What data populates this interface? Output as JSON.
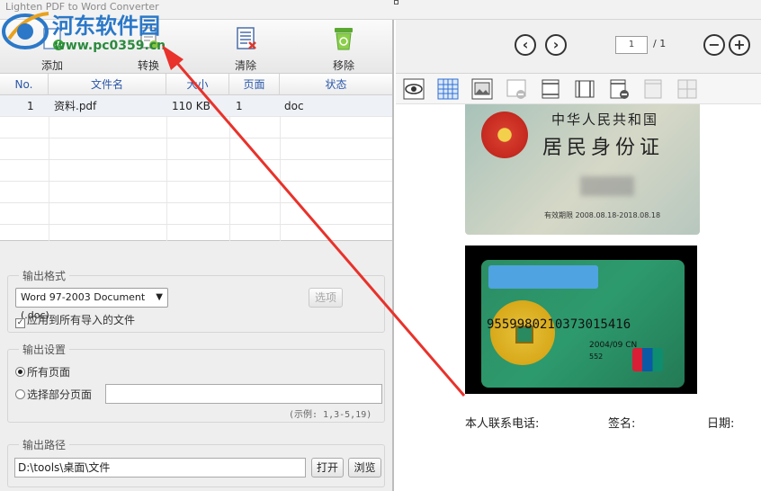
{
  "window": {
    "title": "Lighten PDF to Word Converter"
  },
  "toolbar": {
    "add_label": "添加",
    "convert_label": "转换",
    "clear_label": "清除",
    "remove_label": "移除"
  },
  "table": {
    "columns": [
      "No.",
      "文件名",
      "大小",
      "页面",
      "状态"
    ],
    "rows": [
      {
        "no": "1",
        "filename": "资料.pdf",
        "size": "110 KB",
        "pages": "1",
        "status": "doc"
      }
    ]
  },
  "output_format": {
    "legend": "输出格式",
    "selected": "Word 97-2003 Document (.doc)",
    "options_button": "选项",
    "apply_all_label": "应用到所有导入的文件",
    "apply_all_checked": true
  },
  "output_settings": {
    "legend": "输出设置",
    "all_pages_label": "所有页面",
    "all_pages_selected": true,
    "some_pages_label": "选择部分页面",
    "some_pages_value": "",
    "example_hint": "(示例: 1,3-5,19)"
  },
  "output_path": {
    "legend": "输出路径",
    "value": "D:\\tools\\桌面\\文件",
    "open_button": "打开",
    "browse_button": "浏览"
  },
  "viewer": {
    "page_current": "1",
    "page_total": "/ 1",
    "prev_icon": "chevron-left-icon",
    "next_icon": "chevron-right-icon",
    "zoom_out_icon": "minus-icon",
    "zoom_in_icon": "plus-icon"
  },
  "document": {
    "id_line1": "中华人民共和国",
    "id_line2": "居民身份证",
    "id_validity": "有效期限  2008.08.18-2018.08.18",
    "card_number": "9559980210373015416",
    "card_expiry": "2004/09 CN",
    "card_code": "552",
    "phone_label": "本人联系电话:",
    "signature_label": "签名:",
    "date_label": "日期:"
  },
  "watermark": {
    "site_name": "河东软件园",
    "url": "www.pc0359.cn"
  },
  "colors": {
    "accent": "#2b78c8",
    "arrow": "#e8322b",
    "header_text": "#2a57a8"
  }
}
